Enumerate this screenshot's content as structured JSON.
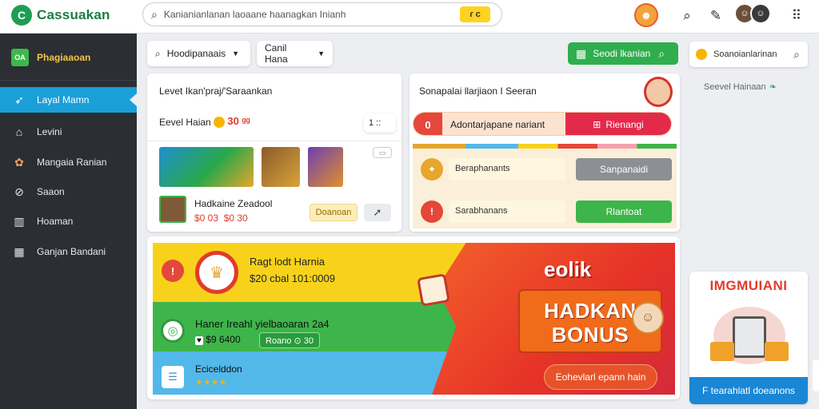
{
  "topbar": {
    "logo_text": "Cassuakan",
    "logo_mark": "C",
    "search_value": "Kanianianlanan laoaane haanagkan Inianh",
    "search_button": "ɾ c",
    "icons": [
      "search-icon",
      "edit-icon",
      "grid-icon"
    ]
  },
  "sidebar": {
    "header_badge": "OA",
    "header_label": "Phagiaaoan",
    "items": [
      {
        "label": "Layal Mamn",
        "icon": "bird-icon",
        "active": true
      },
      {
        "label": "Levini",
        "icon": "home-icon",
        "active": false
      },
      {
        "label": "Mangaia Ranian",
        "icon": "flower-icon",
        "active": false
      },
      {
        "label": "Saaon",
        "icon": "compass-icon",
        "active": false
      },
      {
        "label": "Hoaman",
        "icon": "chart-icon",
        "active": false
      },
      {
        "label": "Ganjan Bandani",
        "icon": "store-icon",
        "active": false
      }
    ]
  },
  "toolbar": {
    "filter_label": "Hoodipanaais",
    "sort_label": "Canil Hana",
    "action_label": "Seodi lkanian",
    "right_search_label": "Soanoianlarinan",
    "right_note": "Seevel Hainaan"
  },
  "level_panel": {
    "title": "Levet Ikan'praj/'Saraankan",
    "level_label": "Eevel Haian",
    "level_value": "30 ᵍᵍ",
    "counter": "1 ::",
    "item_name": "Hadkaine Zeadool",
    "item_price": "$0 03",
    "item_price2": "$0 30",
    "item_button": "Doanoan"
  },
  "task_panel": {
    "title": "Sonapalai llarjiaon I Seeran",
    "bar_value": "0",
    "bar_text": "Adontarjapane nariant",
    "bar_button": "Rienangi",
    "rows": [
      {
        "label": "Beraphanants",
        "button": "Sanpanaidi"
      },
      {
        "label": "Sarabhanans",
        "button": "Rlantoat"
      }
    ]
  },
  "promo": {
    "row1_title": "Ragt lodt Harnia",
    "row1_sub": "$20 cbal 101:0009",
    "row2_title": "Haner Ireahl yielbaoaran 2a4",
    "row2_price": "$9 6400",
    "row2_button": "Roano ⊙ 30",
    "row3_title": "Ecicelddon",
    "rating": "★★★★",
    "headline_top": "eolik",
    "headline_line1": "HADKAN",
    "headline_line2": "BONUS",
    "cta": "Eohevlarl epann hain"
  },
  "ad": {
    "title": "IMGMUIANI",
    "cta": "F tearahlatl doeanons"
  },
  "colors": {
    "accent_blue": "#1a9fd8",
    "brand_green": "#2fae4e",
    "alert_red": "#e23b2a",
    "banner_yellow": "#f8d21a"
  }
}
